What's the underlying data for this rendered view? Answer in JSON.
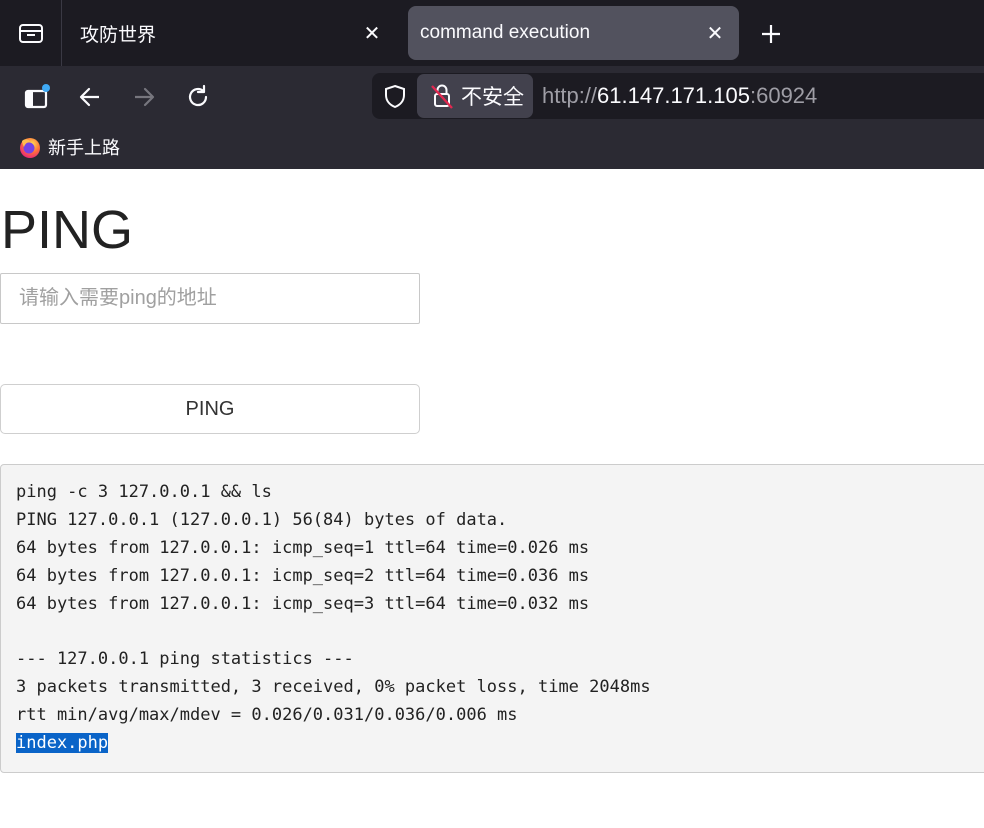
{
  "browser": {
    "tabs": [
      {
        "title": "攻防世界",
        "active": false
      },
      {
        "title": "command execution",
        "active": true
      }
    ],
    "urlbar": {
      "security_label": "不安全",
      "url_scheme": "http://",
      "url_host": "61.147.171.105",
      "url_port": ":60924"
    },
    "bookmarks": [
      {
        "label": "新手上路",
        "icon": "firefox-icon"
      }
    ]
  },
  "page": {
    "title": "PING",
    "input": {
      "placeholder": "请输入需要ping的地址",
      "value": ""
    },
    "button_label": "PING",
    "output_lines": [
      "ping -c 3 127.0.0.1 && ls",
      "PING 127.0.0.1 (127.0.0.1) 56(84) bytes of data.",
      "64 bytes from 127.0.0.1: icmp_seq=1 ttl=64 time=0.026 ms",
      "64 bytes from 127.0.0.1: icmp_seq=2 ttl=64 time=0.036 ms",
      "64 bytes from 127.0.0.1: icmp_seq=3 ttl=64 time=0.032 ms",
      "",
      "--- 127.0.0.1 ping statistics ---",
      "3 packets transmitted, 3 received, 0% packet loss, time 2048ms",
      "rtt min/avg/max/mdev = 0.026/0.031/0.036/0.006 ms",
      "index.php"
    ],
    "selected_text": "index.php"
  },
  "colors": {
    "tabbar_bg": "#1c1b22",
    "toolbar_bg": "#2b2a33",
    "active_tab_bg": "#52525e",
    "selection": "#0a64c8",
    "output_bg": "#f4f4f4"
  }
}
